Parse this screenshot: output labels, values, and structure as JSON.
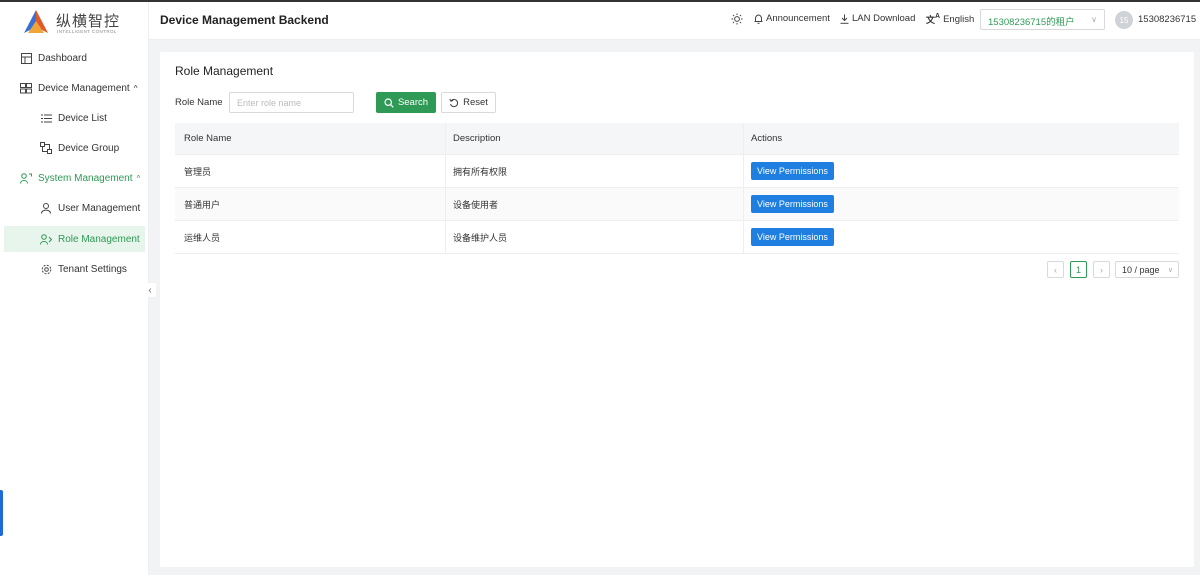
{
  "brand": {
    "name_cn": "纵横智控",
    "name_en": "INTELLIGENT CONTROL"
  },
  "header": {
    "title": "Device Management Backend",
    "announcement": "Announcement",
    "lan_download": "LAN Download",
    "language": "English",
    "tenant": "15308236715的租户",
    "avatar_initials": "15",
    "username": "15308236715"
  },
  "sidebar": {
    "items": [
      {
        "label": "Dashboard",
        "icon": "dashboard-icon"
      },
      {
        "label": "Device Management",
        "icon": "devices-icon"
      },
      {
        "label": "Device List",
        "icon": "list-icon"
      },
      {
        "label": "Device Group",
        "icon": "group-icon"
      },
      {
        "label": "System Management",
        "icon": "users-cog-icon"
      },
      {
        "label": "User Management",
        "icon": "user-icon"
      },
      {
        "label": "Role Management",
        "icon": "role-icon"
      },
      {
        "label": "Tenant Settings",
        "icon": "gear-icon"
      }
    ]
  },
  "page": {
    "title": "Role Management",
    "filter_label": "Role Name",
    "filter_placeholder": "Enter role name",
    "search_label": "Search",
    "reset_label": "Reset"
  },
  "table": {
    "columns": [
      "Role Name",
      "Description",
      "Actions"
    ],
    "rows": [
      {
        "name": "管理员",
        "description": "拥有所有权限",
        "action": "View Permissions"
      },
      {
        "name": "普通用户",
        "description": "设备使用者",
        "action": "View Permissions"
      },
      {
        "name": "运维人员",
        "description": "设备维护人员",
        "action": "View Permissions"
      }
    ]
  },
  "pagination": {
    "current_page": "1",
    "page_size": "10 / page"
  },
  "colors": {
    "primary_green": "#2e9a55",
    "action_blue": "#1e7fe0"
  }
}
